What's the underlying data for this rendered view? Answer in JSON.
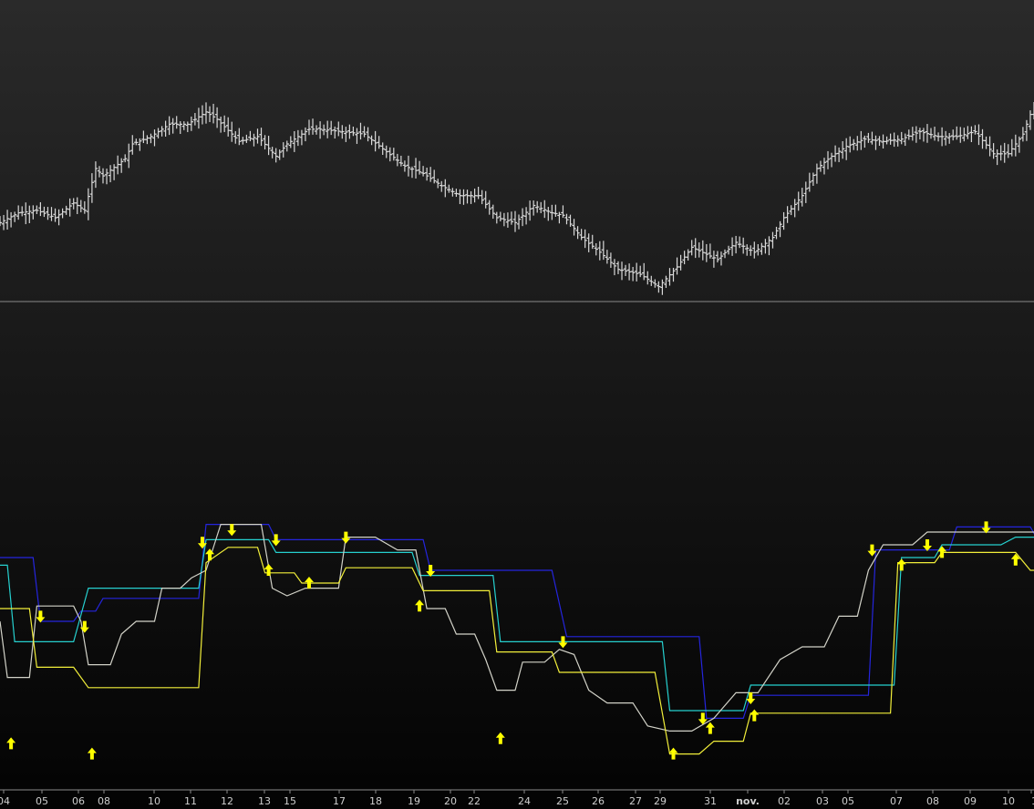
{
  "chart_data": [
    {
      "type": "ohlc",
      "panel": "price",
      "bar_count": 282,
      "ylim": [
        0,
        100
      ],
      "bar_color": "#d9d9d9",
      "close_path": [
        [
          0,
          28
        ],
        [
          5,
          32
        ],
        [
          10,
          33
        ],
        [
          15,
          30
        ],
        [
          20,
          36
        ],
        [
          23,
          33
        ],
        [
          26,
          50
        ],
        [
          28,
          47
        ],
        [
          34,
          54
        ],
        [
          36,
          60
        ],
        [
          41,
          63
        ],
        [
          46,
          68
        ],
        [
          51,
          68
        ],
        [
          56,
          73
        ],
        [
          59,
          70
        ],
        [
          65,
          61
        ],
        [
          70,
          63
        ],
        [
          75,
          55
        ],
        [
          78,
          60
        ],
        [
          84,
          66
        ],
        [
          87,
          66
        ],
        [
          93,
          65
        ],
        [
          99,
          64
        ],
        [
          104,
          58
        ],
        [
          110,
          51
        ],
        [
          115,
          48
        ],
        [
          120,
          43
        ],
        [
          125,
          39
        ],
        [
          130,
          39
        ],
        [
          135,
          30
        ],
        [
          140,
          28
        ],
        [
          145,
          35
        ],
        [
          150,
          32
        ],
        [
          153,
          31
        ],
        [
          158,
          22
        ],
        [
          163,
          16
        ],
        [
          168,
          9
        ],
        [
          174,
          7
        ],
        [
          179,
          2
        ],
        [
          184,
          10
        ],
        [
          188,
          18
        ],
        [
          195,
          13
        ],
        [
          200,
          20
        ],
        [
          205,
          16
        ],
        [
          210,
          22
        ],
        [
          213,
          30
        ],
        [
          218,
          39
        ],
        [
          222,
          50
        ],
        [
          226,
          55
        ],
        [
          230,
          59
        ],
        [
          235,
          62
        ],
        [
          240,
          61
        ],
        [
          245,
          62
        ],
        [
          250,
          65
        ],
        [
          255,
          63
        ],
        [
          260,
          63
        ],
        [
          265,
          65
        ],
        [
          270,
          56
        ],
        [
          274,
          56
        ],
        [
          278,
          64
        ],
        [
          281,
          76
        ]
      ],
      "x_ticks": [
        "04",
        "05",
        "06",
        "08",
        "10",
        "11",
        "12",
        "13",
        "15",
        "17",
        "18",
        "19",
        "20",
        "22",
        "24",
        "25",
        "26",
        "27",
        "29",
        "31",
        "nov.",
        "02",
        "03",
        "05",
        "07",
        "08",
        "09",
        "10",
        "1"
      ]
    },
    {
      "type": "line",
      "panel": "indicator",
      "ylim": [
        0,
        100
      ],
      "x": [
        0,
        282
      ],
      "series": [
        {
          "color": "#2525dd",
          "points": [
            [
              0,
              85
            ],
            [
              9,
              85
            ],
            [
              11,
              60
            ],
            [
              20,
              60
            ],
            [
              22,
              64
            ],
            [
              26,
              64
            ],
            [
              28,
              69
            ],
            [
              54,
              69
            ],
            [
              56,
              98
            ],
            [
              73,
              98
            ],
            [
              75,
              92
            ],
            [
              115,
              92
            ],
            [
              117,
              80
            ],
            [
              150,
              80
            ],
            [
              154,
              54
            ],
            [
              190,
              54
            ],
            [
              192,
              22
            ],
            [
              202,
              22
            ],
            [
              204,
              31
            ],
            [
              236,
              31
            ],
            [
              238,
              88
            ],
            [
              258,
              88
            ],
            [
              260,
              97
            ],
            [
              280,
              97
            ],
            [
              282,
              92
            ]
          ]
        },
        {
          "color": "#26d0cf",
          "points": [
            [
              0,
              82
            ],
            [
              2,
              82
            ],
            [
              4,
              52
            ],
            [
              20,
              52
            ],
            [
              24,
              73
            ],
            [
              54,
              73
            ],
            [
              56,
              92
            ],
            [
              73,
              92
            ],
            [
              75,
              87
            ],
            [
              112,
              87
            ],
            [
              114,
              78
            ],
            [
              134,
              78
            ],
            [
              136,
              52
            ],
            [
              180,
              52
            ],
            [
              182,
              25
            ],
            [
              202,
              25
            ],
            [
              204,
              35
            ],
            [
              243,
              35
            ],
            [
              245,
              85
            ],
            [
              254,
              85
            ],
            [
              256,
              90
            ],
            [
              272,
              90
            ],
            [
              276,
              93
            ],
            [
              282,
              93
            ]
          ]
        },
        {
          "color": "#d2d2c8",
          "points": [
            [
              0,
              60
            ],
            [
              2,
              38
            ],
            [
              8,
              38
            ],
            [
              10,
              66
            ],
            [
              20,
              66
            ],
            [
              22,
              60
            ],
            [
              24,
              43
            ],
            [
              30,
              43
            ],
            [
              33,
              55
            ],
            [
              37,
              60
            ],
            [
              42,
              60
            ],
            [
              44,
              73
            ],
            [
              49,
              73
            ],
            [
              52,
              77
            ],
            [
              56,
              80
            ],
            [
              60,
              98
            ],
            [
              71,
              98
            ],
            [
              74,
              73
            ],
            [
              78,
              70
            ],
            [
              83,
              73
            ],
            [
              92,
              73
            ],
            [
              94,
              93
            ],
            [
              102,
              93
            ],
            [
              108,
              88
            ],
            [
              113,
              88
            ],
            [
              116,
              65
            ],
            [
              121,
              65
            ],
            [
              124,
              55
            ],
            [
              129,
              55
            ],
            [
              132,
              45
            ],
            [
              135,
              33
            ],
            [
              140,
              33
            ],
            [
              142,
              44
            ],
            [
              148,
              44
            ],
            [
              152,
              49
            ],
            [
              156,
              47
            ],
            [
              160,
              33
            ],
            [
              165,
              28
            ],
            [
              172,
              28
            ],
            [
              176,
              19
            ],
            [
              182,
              17
            ],
            [
              188,
              17
            ],
            [
              194,
              22
            ],
            [
              200,
              32
            ],
            [
              206,
              32
            ],
            [
              212,
              45
            ],
            [
              218,
              50
            ],
            [
              224,
              50
            ],
            [
              228,
              62
            ],
            [
              233,
              62
            ],
            [
              236,
              80
            ],
            [
              240,
              90
            ],
            [
              248,
              90
            ],
            [
              252,
              95
            ],
            [
              282,
              95
            ]
          ]
        },
        {
          "color": "#f2ef3a",
          "points": [
            [
              0,
              65
            ],
            [
              8,
              65
            ],
            [
              10,
              42
            ],
            [
              20,
              42
            ],
            [
              24,
              34
            ],
            [
              54,
              34
            ],
            [
              56,
              83
            ],
            [
              62,
              89
            ],
            [
              70,
              89
            ],
            [
              72,
              79
            ],
            [
              80,
              79
            ],
            [
              82,
              75
            ],
            [
              92,
              75
            ],
            [
              94,
              81
            ],
            [
              112,
              81
            ],
            [
              115,
              72
            ],
            [
              133,
              72
            ],
            [
              135,
              48
            ],
            [
              150,
              48
            ],
            [
              152,
              40
            ],
            [
              178,
              40
            ],
            [
              182,
              8
            ],
            [
              190,
              8
            ],
            [
              194,
              13
            ],
            [
              202,
              13
            ],
            [
              204,
              24
            ],
            [
              242,
              24
            ],
            [
              244,
              83
            ],
            [
              254,
              83
            ],
            [
              256,
              87
            ],
            [
              276,
              87
            ],
            [
              280,
              80
            ],
            [
              282,
              80
            ]
          ]
        }
      ],
      "markers_up": [
        [
          3,
          12
        ],
        [
          25,
          8
        ],
        [
          57,
          86
        ],
        [
          73,
          80
        ],
        [
          84,
          75
        ],
        [
          114,
          66
        ],
        [
          136,
          14
        ],
        [
          183,
          8
        ],
        [
          193,
          18
        ],
        [
          205,
          23
        ],
        [
          245,
          82
        ],
        [
          256,
          87
        ],
        [
          276,
          84
        ]
      ],
      "markers_down": [
        [
          11,
          62
        ],
        [
          23,
          58
        ],
        [
          55,
          91
        ],
        [
          63,
          96
        ],
        [
          75,
          92
        ],
        [
          94,
          93
        ],
        [
          117,
          80
        ],
        [
          153,
          52
        ],
        [
          191,
          22
        ],
        [
          204,
          30
        ],
        [
          237,
          88
        ],
        [
          252,
          90
        ],
        [
          268,
          97
        ]
      ],
      "marker_color": "#ffff00"
    }
  ]
}
